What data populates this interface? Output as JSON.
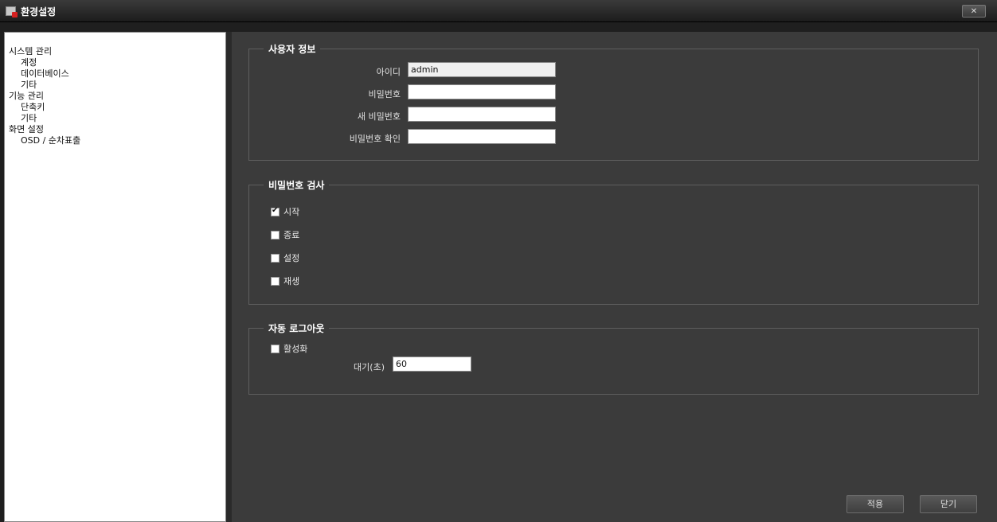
{
  "window": {
    "title": "환경설정",
    "close_label": "✕"
  },
  "sidebar": {
    "items": [
      {
        "label": "시스템 관리",
        "level": 1
      },
      {
        "label": "계정",
        "level": 2
      },
      {
        "label": "데이터베이스",
        "level": 2
      },
      {
        "label": "기타",
        "level": 2
      },
      {
        "label": "기능 관리",
        "level": 1
      },
      {
        "label": "단축키",
        "level": 2
      },
      {
        "label": "기타",
        "level": 2
      },
      {
        "label": "화면 설정",
        "level": 1
      },
      {
        "label": "OSD / 순차표출",
        "level": 2
      }
    ]
  },
  "user_info": {
    "legend": "사용자 정보",
    "id_label": "아이디",
    "id_value": "admin",
    "password_label": "비밀번호",
    "password_value": "",
    "new_password_label": "새 비밀번호",
    "new_password_value": "",
    "confirm_label": "비밀번호 확인",
    "confirm_value": ""
  },
  "password_check": {
    "legend": "비밀번호 검사",
    "options": [
      {
        "label": "시작",
        "checked": true
      },
      {
        "label": "종료",
        "checked": false
      },
      {
        "label": "설정",
        "checked": false
      },
      {
        "label": "재생",
        "checked": false
      }
    ]
  },
  "auto_logout": {
    "legend": "자동 로그아웃",
    "enable_label": "활성화",
    "enable_checked": false,
    "wait_label": "대기(초)",
    "wait_value": "60"
  },
  "buttons": {
    "apply": "적용",
    "close": "닫기"
  }
}
